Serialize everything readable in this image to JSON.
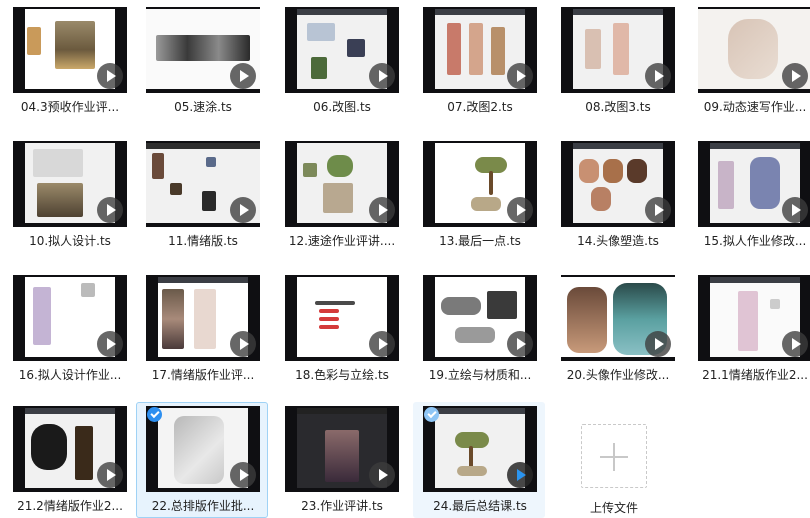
{
  "files": [
    {
      "name": "04.3预收作业评..."
    },
    {
      "name": "05.速涂.ts"
    },
    {
      "name": "06.改图.ts"
    },
    {
      "name": "07.改图2.ts"
    },
    {
      "name": "08.改图3.ts"
    },
    {
      "name": "09.动态速写作业..."
    },
    {
      "name": "10.拟人设计.ts"
    },
    {
      "name": "11.情绪版.ts"
    },
    {
      "name": "12.速途作业评讲...."
    },
    {
      "name": "13.最后一点.ts"
    },
    {
      "name": "14.头像塑造.ts"
    },
    {
      "name": "15.拟人作业修改..."
    },
    {
      "name": "16.拟人设计作业..."
    },
    {
      "name": "17.情绪版作业评..."
    },
    {
      "name": "18.色彩与立绘.ts"
    },
    {
      "name": "19.立绘与材质和..."
    },
    {
      "name": "20.头像作业修改..."
    },
    {
      "name": "21.1情绪版作业2..."
    },
    {
      "name": "21.2情绪版作业2..."
    },
    {
      "name": "22.总排版作业批..."
    },
    {
      "name": "23.作业评讲.ts"
    },
    {
      "name": "24.最后总结课.ts"
    }
  ],
  "upload": {
    "label": "上传文件"
  }
}
